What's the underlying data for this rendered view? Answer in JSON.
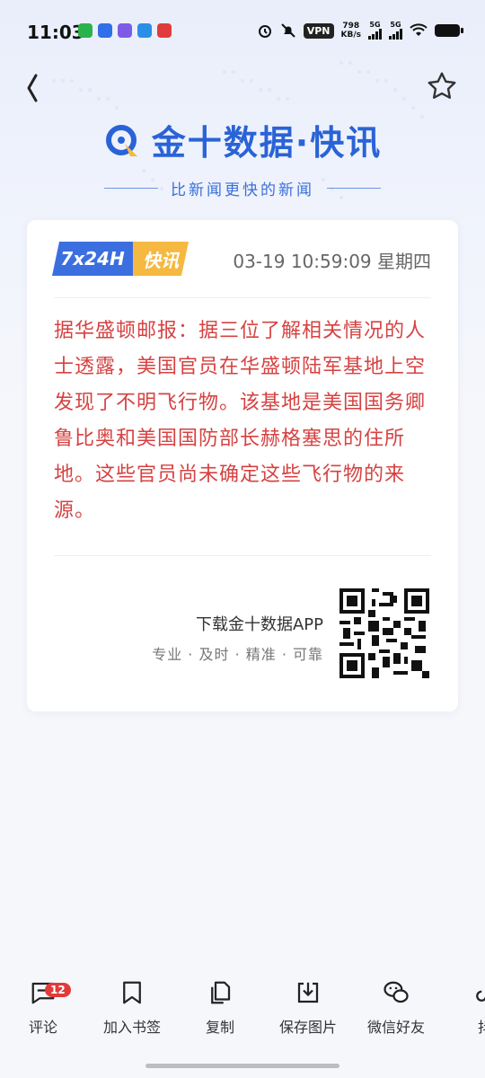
{
  "status_bar": {
    "time": "11:03",
    "vpn_label": "VPN",
    "net_speed_value": "798",
    "net_speed_unit": "KB/s",
    "signal1": "5G",
    "signal2": "5G"
  },
  "brand": {
    "name": "金十数据·快讯",
    "slogan": "比新闻更快的新闻"
  },
  "card": {
    "badge_left": "7x24H",
    "badge_right": "快讯",
    "datetime": "03-19 10:59:09 星期四",
    "content": "据华盛顿邮报：据三位了解相关情况的人士透露，美国官员在华盛顿陆军基地上空发现了不明飞行物。该基地是美国国务卿鲁比奥和美国国防部长赫格塞思的住所地。这些官员尚未确定这些飞行物的来源。",
    "promo_title": "下载金十数据APP",
    "promo_tagline": "专业 · 及时 · 精准 · 可靠"
  },
  "bottom_bar": {
    "comment_count": "12",
    "items": [
      {
        "label": "评论",
        "icon": "comment-icon"
      },
      {
        "label": "加入书签",
        "icon": "bookmark-icon"
      },
      {
        "label": "复制",
        "icon": "copy-icon"
      },
      {
        "label": "保存图片",
        "icon": "download-icon"
      },
      {
        "label": "微信好友",
        "icon": "wechat-icon"
      },
      {
        "label": "抖",
        "icon": "douyin-icon"
      }
    ]
  },
  "colors": {
    "brand_blue": "#2a63d6",
    "news_red": "#d64242",
    "badge_blue": "#3b6fe0",
    "badge_orange": "#f5b840",
    "comment_badge_red": "#e23a3a"
  }
}
